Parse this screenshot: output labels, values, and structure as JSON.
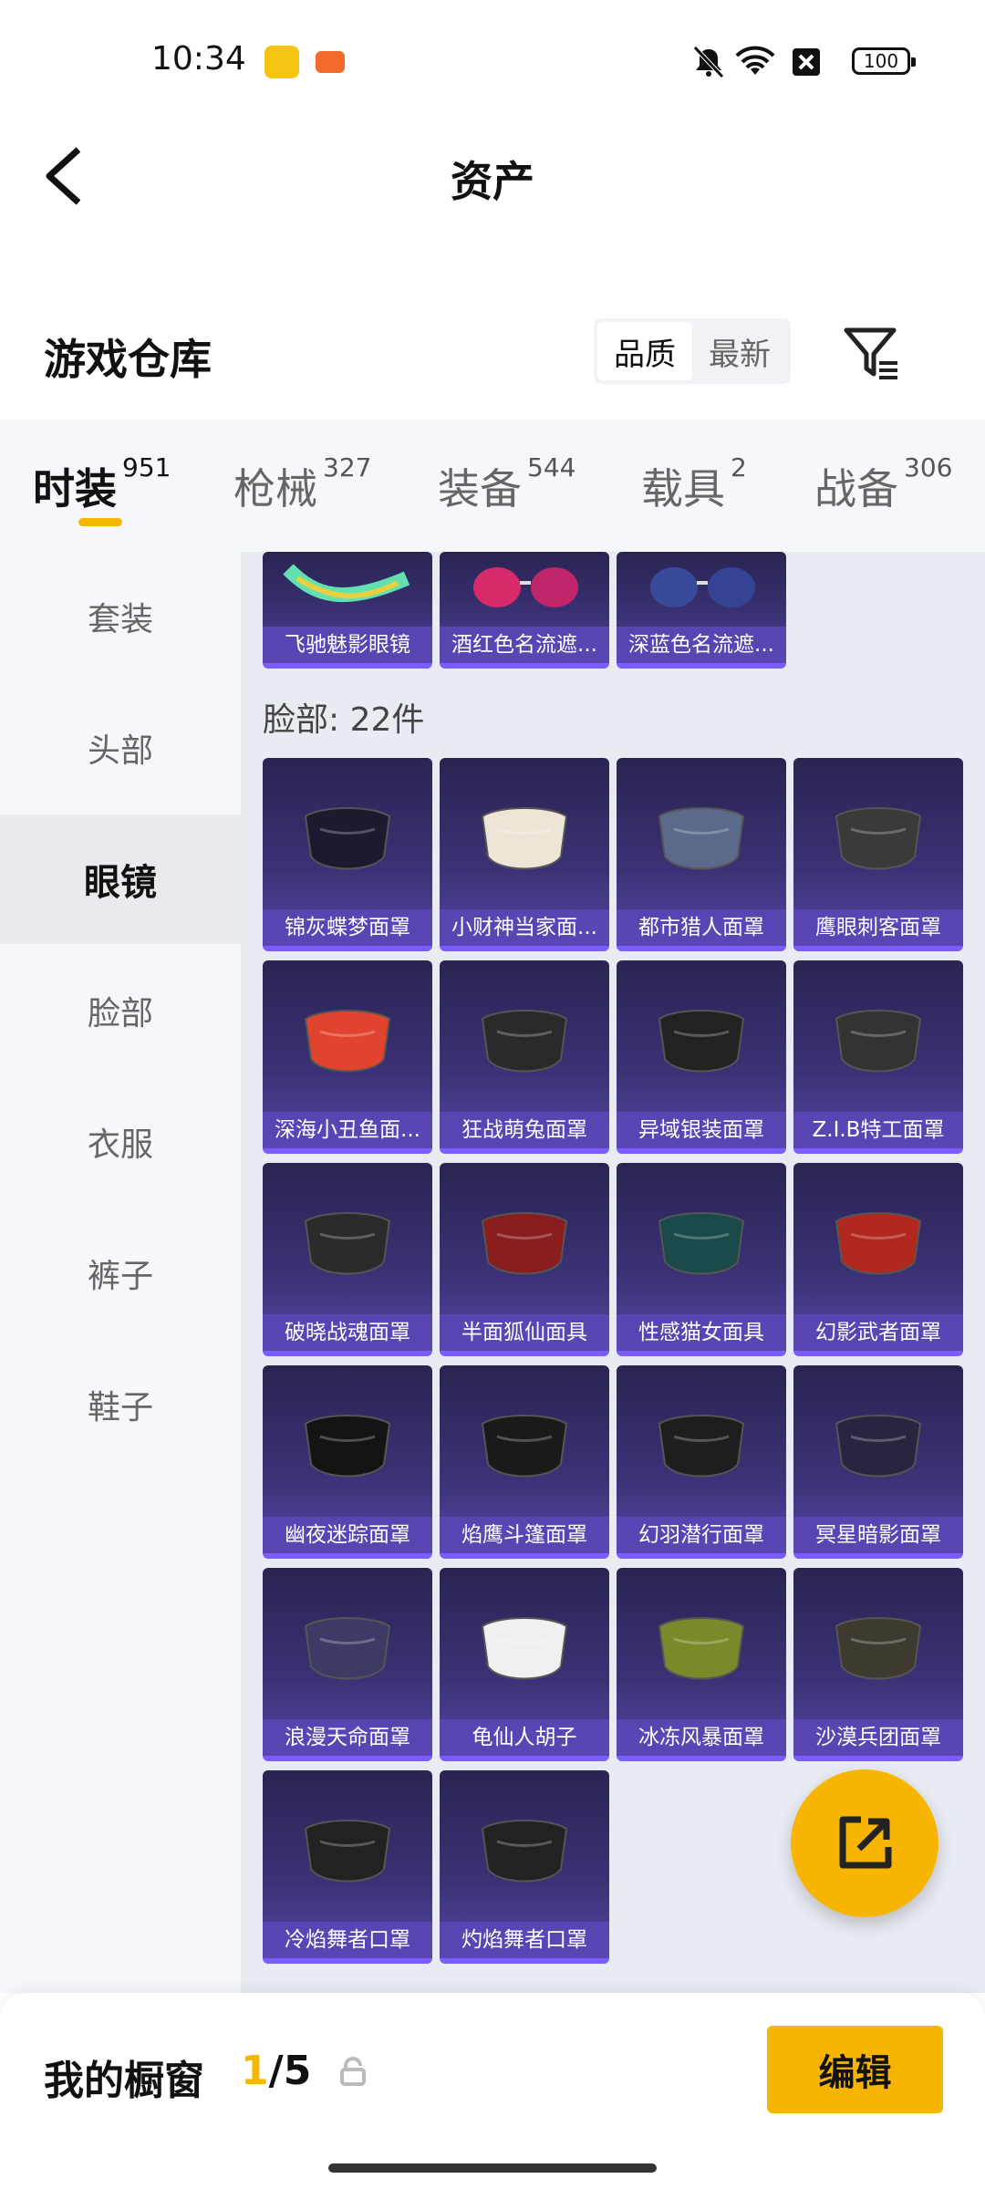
{
  "status": {
    "time": "10:34",
    "battery": "100"
  },
  "header": {
    "title": "资产"
  },
  "warehouse": {
    "title": "游戏仓库",
    "sort_options": [
      "品质",
      "最新"
    ],
    "sort_selected": "品质"
  },
  "tabs": [
    {
      "label": "时装",
      "count": "951",
      "active": true
    },
    {
      "label": "枪械",
      "count": "327",
      "active": false
    },
    {
      "label": "装备",
      "count": "544",
      "active": false
    },
    {
      "label": "载具",
      "count": "2",
      "active": false
    },
    {
      "label": "战备",
      "count": "306",
      "active": false
    }
  ],
  "categories": [
    {
      "label": "套装",
      "active": false
    },
    {
      "label": "头部",
      "active": false
    },
    {
      "label": "眼镜",
      "active": true
    },
    {
      "label": "脸部",
      "active": false
    },
    {
      "label": "衣服",
      "active": false
    },
    {
      "label": "裤子",
      "active": false
    },
    {
      "label": "鞋子",
      "active": false
    }
  ],
  "glasses_partial": [
    {
      "name": "飞驰魅影眼镜"
    },
    {
      "name": "酒红色名流遮..."
    },
    {
      "name": "深蓝色名流遮..."
    }
  ],
  "face_section": {
    "label": "脸部: 22件",
    "items": [
      {
        "name": "锦灰蝶梦面罩",
        "icon": "mask-icon"
      },
      {
        "name": "小财神当家面...",
        "icon": "mustache-icon"
      },
      {
        "name": "都市猎人面罩",
        "icon": "bandana-icon"
      },
      {
        "name": "鹰眼刺客面罩",
        "icon": "plague-mask-icon"
      },
      {
        "name": "深海小丑鱼面...",
        "icon": "snorkel-icon"
      },
      {
        "name": "狂战萌兔面罩",
        "icon": "mask-icon"
      },
      {
        "name": "异域银装面罩",
        "icon": "mask-icon"
      },
      {
        "name": "Z.I.B特工面罩",
        "icon": "mask-icon"
      },
      {
        "name": "破晓战魂面罩",
        "icon": "mask-icon"
      },
      {
        "name": "半面狐仙面具",
        "icon": "fox-mask-icon"
      },
      {
        "name": "性感猫女面具",
        "icon": "cat-mask-icon"
      },
      {
        "name": "幻影武者面罩",
        "icon": "gas-mask-icon"
      },
      {
        "name": "幽夜迷踪面罩",
        "icon": "mask-icon"
      },
      {
        "name": "焰鹰斗篷面罩",
        "icon": "mask-icon"
      },
      {
        "name": "幻羽潜行面罩",
        "icon": "mask-icon"
      },
      {
        "name": "冥星暗影面罩",
        "icon": "mask-icon"
      },
      {
        "name": "浪漫天命面罩",
        "icon": "mask-icon"
      },
      {
        "name": "龟仙人胡子",
        "icon": "beard-icon"
      },
      {
        "name": "冰冻风暴面罩",
        "icon": "gaiter-icon"
      },
      {
        "name": "沙漠兵团面罩",
        "icon": "mask-icon"
      },
      {
        "name": "冷焰舞者口罩",
        "icon": "flame-mask-icon"
      },
      {
        "name": "灼焰舞者口罩",
        "icon": "flame-mask-icon"
      }
    ]
  },
  "bottom": {
    "title": "我的橱窗",
    "current": "1",
    "total": "/5",
    "edit_label": "编辑"
  },
  "colors": {
    "accent": "#f7b500",
    "card_bg": "#3b3276",
    "card_label": "#5a46b4"
  }
}
